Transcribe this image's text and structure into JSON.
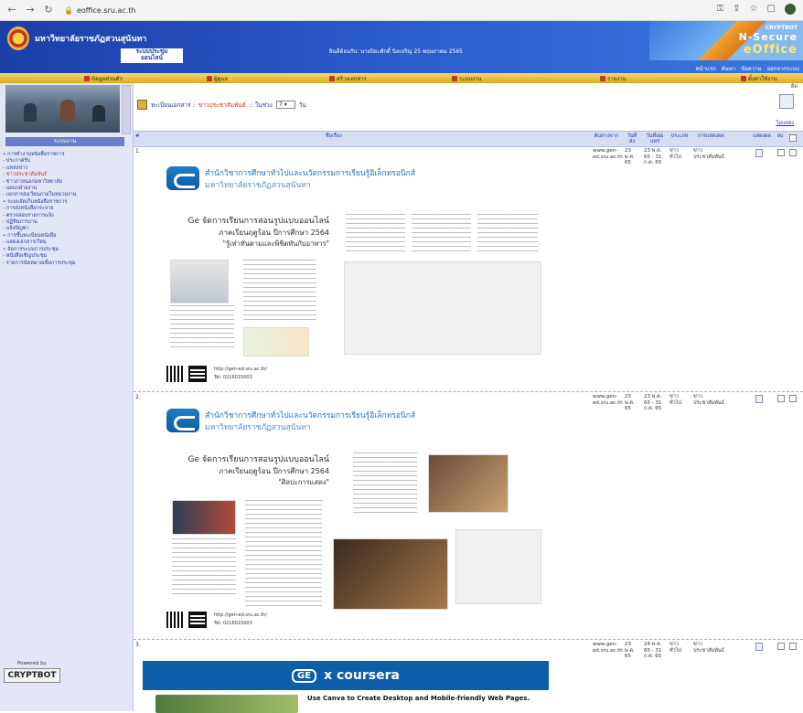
{
  "browser": {
    "url": "eoffice.sru.ac.th"
  },
  "header": {
    "university_name": "มหาวิทยาลัยราชภัฏสวนสุนันทา",
    "system_name": "ระบบประชุม\nออนไลน์",
    "user_info": "ยินดีต้อนรับ: นายปิยะศักดิ์ นิลเจริญ   25 พฤษภาคม 2565",
    "brand_line1": "CRYPTBOT",
    "brand_line2": "N-Secure",
    "brand_line3": "eOffice",
    "top_links": [
      "หน้าแรก",
      "ค้นหา",
      "ข้อความ",
      "ออกจากระบบ"
    ]
  },
  "menubar": {
    "items": [
      "ข้อมูลส่วนตัว",
      "ผู้ดูแล",
      "สร้างเอกสาร",
      "ระบบงาน",
      "รายงาน",
      "ตั้งค่าใช้งาน"
    ]
  },
  "sidebar": {
    "heading": "ระบบงาน",
    "items": [
      "• การทำงานหนังสือราชการ",
      "- ประกาศรับ",
      "- แหล่งข่าว",
      "- ข่าวประชาสัมพันธ์",
      "- ข่าวภายนอกมหาวิทยาลัย",
      "- แผนกฝ่ายงาน",
      "- เอกสารส่งเวียนภายในหน่วยงาน",
      "• ระบบจัดเก็บหนังสือราชการ",
      "- การส่งหนังสือกระจาย",
      "- ตรวจสอบรายการแจ้ง",
      "- ปฏิทินการงาน",
      "- แจ้งปัญหา",
      "• การขึ้นทะเบียนหนังสือ",
      "- แสดงเอกสารเวียน",
      "• จัดการระบบการประชุม",
      "- หนังสือเชิญประชุม",
      "- รายการนัดหมายเพื่อการประชุม"
    ],
    "selected_index": 3,
    "footer_label": "Powered by",
    "footer_brand": "CRYPTBOT"
  },
  "main": {
    "breadcrumb_prefix": "ทะเบียนเอกสาร :",
    "breadcrumb_current": "ข่าวประชาสัมพันธ์",
    "breadcrumb_suffix": ":: ในช่วง",
    "period_value": "7",
    "period_unit": "วัน",
    "legend": "ดิด",
    "all_link": "ไม่แสดง",
    "columns": [
      "#",
      "ชื่อเรื่อง",
      "ต้นทางจาก",
      "วันที่ ส่ง",
      "วันที่เผยแพร่",
      "ประเภท",
      "การแสดงผล",
      "แสดงผล",
      "ลบ"
    ],
    "rows": [
      {
        "num": "1.",
        "source": "www.gen-ed.sru.ac.th",
        "sent": "23 พ.ค. 65",
        "published": "23 พ.ค. 65 - 31 ก.ค. 65",
        "type": "ข่าวทั่วไป",
        "display": "ข่าวประชาสัมพันธ์",
        "poster": {
          "org_line1": "สำนักวิชาการศึกษาทั่วไปและนวัตกรรมการเรียนรู้อิเล็กทรอนิกส์",
          "org_line2": "มหาวิทยาลัยราชภัฏสวนสุนันทา",
          "head1": "Ge จัดการเรียนการสอนรูปแบบออนไลน์",
          "head2": "ภาคเรียนฤดูร้อน ปีการศึกษา 2564",
          "head3": "\"รู้เท่าทันตามและพิชิตทันกับอาหาร\"",
          "url": "http://gen-ed.sru.ac.th/",
          "tel": "Tel: 0216015003"
        }
      },
      {
        "num": "2.",
        "source": "www.gen-ed.sru.ac.th",
        "sent": "23 พ.ค. 65",
        "published": "23 พ.ค. 65 - 31 ก.ค. 65",
        "type": "ข่าวทั่วไป",
        "display": "ข่าวประชาสัมพันธ์",
        "poster": {
          "org_line1": "สำนักวิชาการศึกษาทั่วไปและนวัตกรรมการเรียนรู้อิเล็กทรอนิกส์",
          "org_line2": "มหาวิทยาลัยราชภัฏสวนสุนันทา",
          "head1": "Ge จัดการเรียนการสอนรูปแบบออนไลน์",
          "head2": "ภาคเรียนฤดูร้อน ปีการศึกษา 2564",
          "head3": "\"ศิลปะการแสดง\"",
          "url": "http://gen-ed.sru.ac.th/",
          "tel": "Tel: 0216015003"
        }
      },
      {
        "num": "3.",
        "source": "www.gen-ed.sru.ac.th",
        "sent": "23 พ.ค. 65",
        "published": "24 พ.ค. 65 - 31 ก.ค. 65",
        "type": "ข่าวทั่วไป",
        "display": "ข่าวประชาสัมพันธ์",
        "banner": "x coursera",
        "banner_logo": "GE",
        "canva_title": "Use Canva to Create Desktop and Mobile-friendly Web Pages."
      }
    ]
  }
}
